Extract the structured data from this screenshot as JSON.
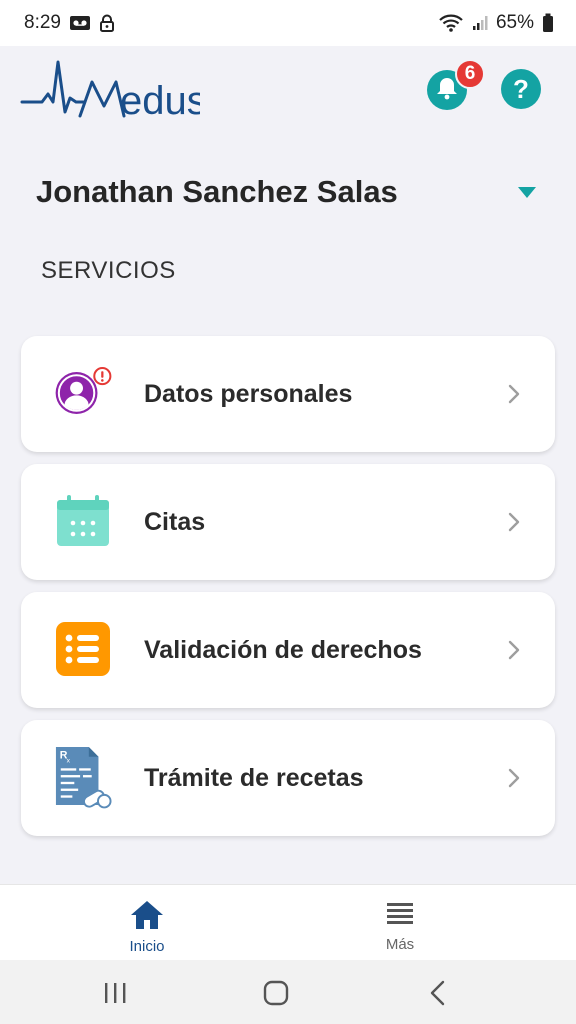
{
  "status_bar": {
    "time": "8:29",
    "battery": "65%"
  },
  "header": {
    "logo_text": "edus",
    "notification_count": "6",
    "help_symbol": "?"
  },
  "user": {
    "name": "Jonathan Sanchez Salas"
  },
  "section_title": "SERVICIOS",
  "services": [
    {
      "label": "Datos personales",
      "icon": "person-icon",
      "alert": true
    },
    {
      "label": "Citas",
      "icon": "calendar-icon"
    },
    {
      "label": "Validación de derechos",
      "icon": "list-icon"
    },
    {
      "label": "Trámite de recetas",
      "icon": "prescription-icon"
    }
  ],
  "bottom_nav": {
    "home_label": "Inicio",
    "more_label": "Más"
  },
  "colors": {
    "teal": "#14a3a3",
    "brand_blue": "#1a4e8a",
    "badge_red": "#e53935",
    "purple": "#8e24aa",
    "mint": "#7ee0cf",
    "orange": "#ff9800"
  }
}
